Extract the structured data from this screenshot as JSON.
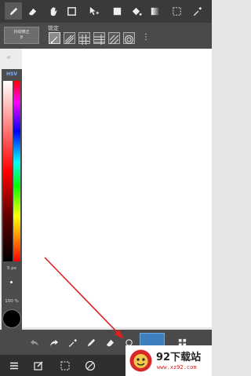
{
  "toolbar": {
    "tools": [
      {
        "name": "pen-icon",
        "active": true
      },
      {
        "name": "eraser-icon"
      },
      {
        "name": "hand-icon"
      },
      {
        "name": "square-select-icon"
      },
      {
        "name": "move-icon"
      },
      {
        "name": "fill-rect-icon"
      },
      {
        "name": "bucket-icon"
      },
      {
        "name": "gradient-icon"
      },
      {
        "name": "marquee-icon"
      },
      {
        "name": "eyedropper-icon"
      }
    ]
  },
  "subbar": {
    "ruler_label_line1": "抖动修正",
    "ruler_label_line2": "8",
    "snap_label": "锁定",
    "snaps": [
      "snap-off",
      "snap-parallel",
      "snap-grid",
      "snap-radial",
      "snap-perspective",
      "snap-circle"
    ],
    "more": "⋮"
  },
  "leftpanel": {
    "collapse_symbol": "«",
    "hsv_label": "HSV",
    "size_label": "5 px",
    "opacity_label": "100 %",
    "current_color": "#000000"
  },
  "actionbar": {
    "buttons": [
      "undo-icon",
      "redo-icon",
      "eyedropper-icon",
      "pen-icon",
      "eraser-icon"
    ],
    "layer_color": "#3d7fbf"
  },
  "bottomnav": {
    "buttons": [
      "menu-icon",
      "edit-icon",
      "select-icon",
      "transform-icon"
    ]
  },
  "watermark": {
    "main": "92下载站",
    "sub": "www.xz92.com"
  },
  "colors": {
    "accent": "#3d7fbf",
    "arrow": "#e02020"
  }
}
